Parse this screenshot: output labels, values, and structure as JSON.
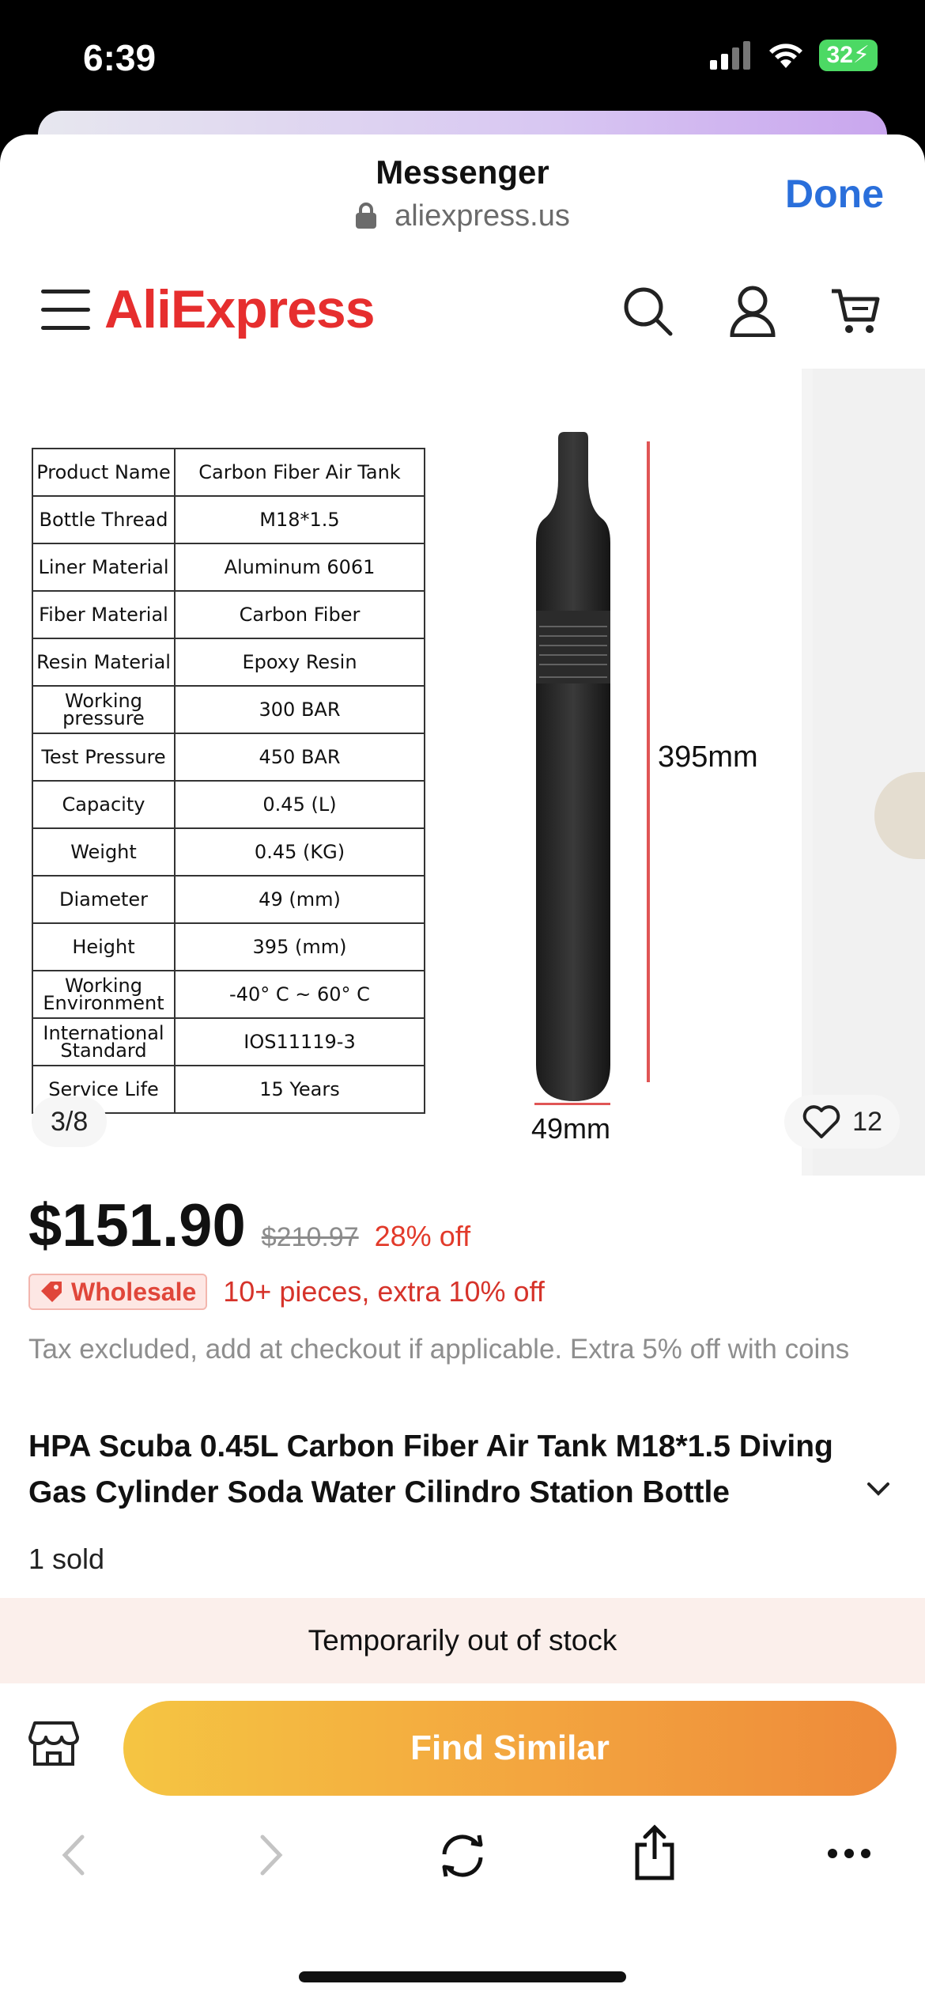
{
  "status_bar": {
    "time": "6:39",
    "battery": "32"
  },
  "browser": {
    "title": "Messenger",
    "url": "aliexpress.us",
    "done_label": "Done"
  },
  "site": {
    "logo": "AliExpress"
  },
  "gallery": {
    "counter": "3/8",
    "likes": "12",
    "spec_table": [
      {
        "key": "Product Name",
        "value": "Carbon Fiber Air Tank"
      },
      {
        "key": "Bottle Thread",
        "value": "M18*1.5"
      },
      {
        "key": "Liner Material",
        "value": "Aluminum 6061"
      },
      {
        "key": "Fiber Material",
        "value": "Carbon Fiber"
      },
      {
        "key": "Resin Material",
        "value": "Epoxy Resin"
      },
      {
        "key": "Working pressure",
        "value": "300 BAR"
      },
      {
        "key": "Test Pressure",
        "value": "450 BAR"
      },
      {
        "key": "Capacity",
        "value": "0.45 (L)"
      },
      {
        "key": "Weight",
        "value": "0.45 (KG)"
      },
      {
        "key": "Diameter",
        "value": "49 (mm)"
      },
      {
        "key": "Height",
        "value": "395 (mm)"
      },
      {
        "key": "Working Environment",
        "value": "-40° C ~ 60° C"
      },
      {
        "key": "International Standard",
        "value": "IOS11119-3"
      },
      {
        "key": "Service Life",
        "value": "15 Years"
      }
    ],
    "height_label": "395mm",
    "diameter_label": "49mm"
  },
  "product": {
    "price": "$151.90",
    "original_price": "$210.97",
    "discount": "28% off",
    "wholesale_badge": "Wholesale",
    "wholesale_text": "10+ pieces, extra 10% off",
    "tax_note": "Tax excluded, add at checkout if applicable. Extra 5% off with coins",
    "title": "HPA Scuba 0.45L Carbon Fiber Air Tank M18*1.5 Diving Gas Cylinder Soda Water Cilindro Station Bottle",
    "sold": "1 sold",
    "stock_status": "Temporarily out of stock",
    "cta_label": "Find Similar"
  },
  "colors": {
    "brand": "#e62e2e",
    "link": "#2a6fdb",
    "discount": "#e23a2a"
  }
}
